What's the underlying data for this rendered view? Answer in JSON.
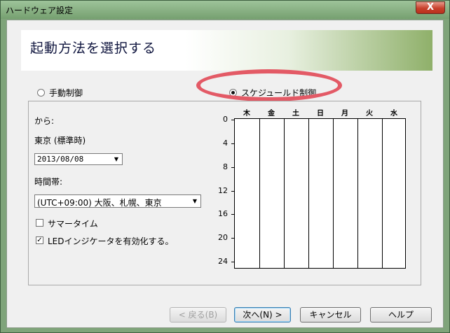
{
  "window": {
    "title": "ハードウェア設定",
    "close_label": "X"
  },
  "banner": {
    "title": "起動方法を選択する"
  },
  "modes": {
    "manual_label": "手動制御",
    "schedule_label": "スケジュールド制御",
    "selected": "schedule"
  },
  "form": {
    "from_label": "から:",
    "tz_caption": "東京 (標準時)",
    "date_value": "2013/08/08",
    "timezone_label": "時間帯:",
    "timezone_value": "(UTC+09:00) 大阪、札幌、東京",
    "summer_time_label": "サマータイム",
    "summer_time_checked": false,
    "led_label": "LEDインジケータを有効化する。",
    "led_checked": true
  },
  "schedule": {
    "days": [
      "木",
      "金",
      "土",
      "日",
      "月",
      "火",
      "水"
    ],
    "hours": [
      "0",
      "4",
      "8",
      "12",
      "16",
      "20",
      "24"
    ]
  },
  "buttons": {
    "back": "< 戻る(B)",
    "next": "次へ(N) >",
    "cancel": "キャンセル",
    "help": "ヘルプ"
  },
  "colors": {
    "highlight": "#e35a66",
    "titlebar": "#8fb589"
  }
}
